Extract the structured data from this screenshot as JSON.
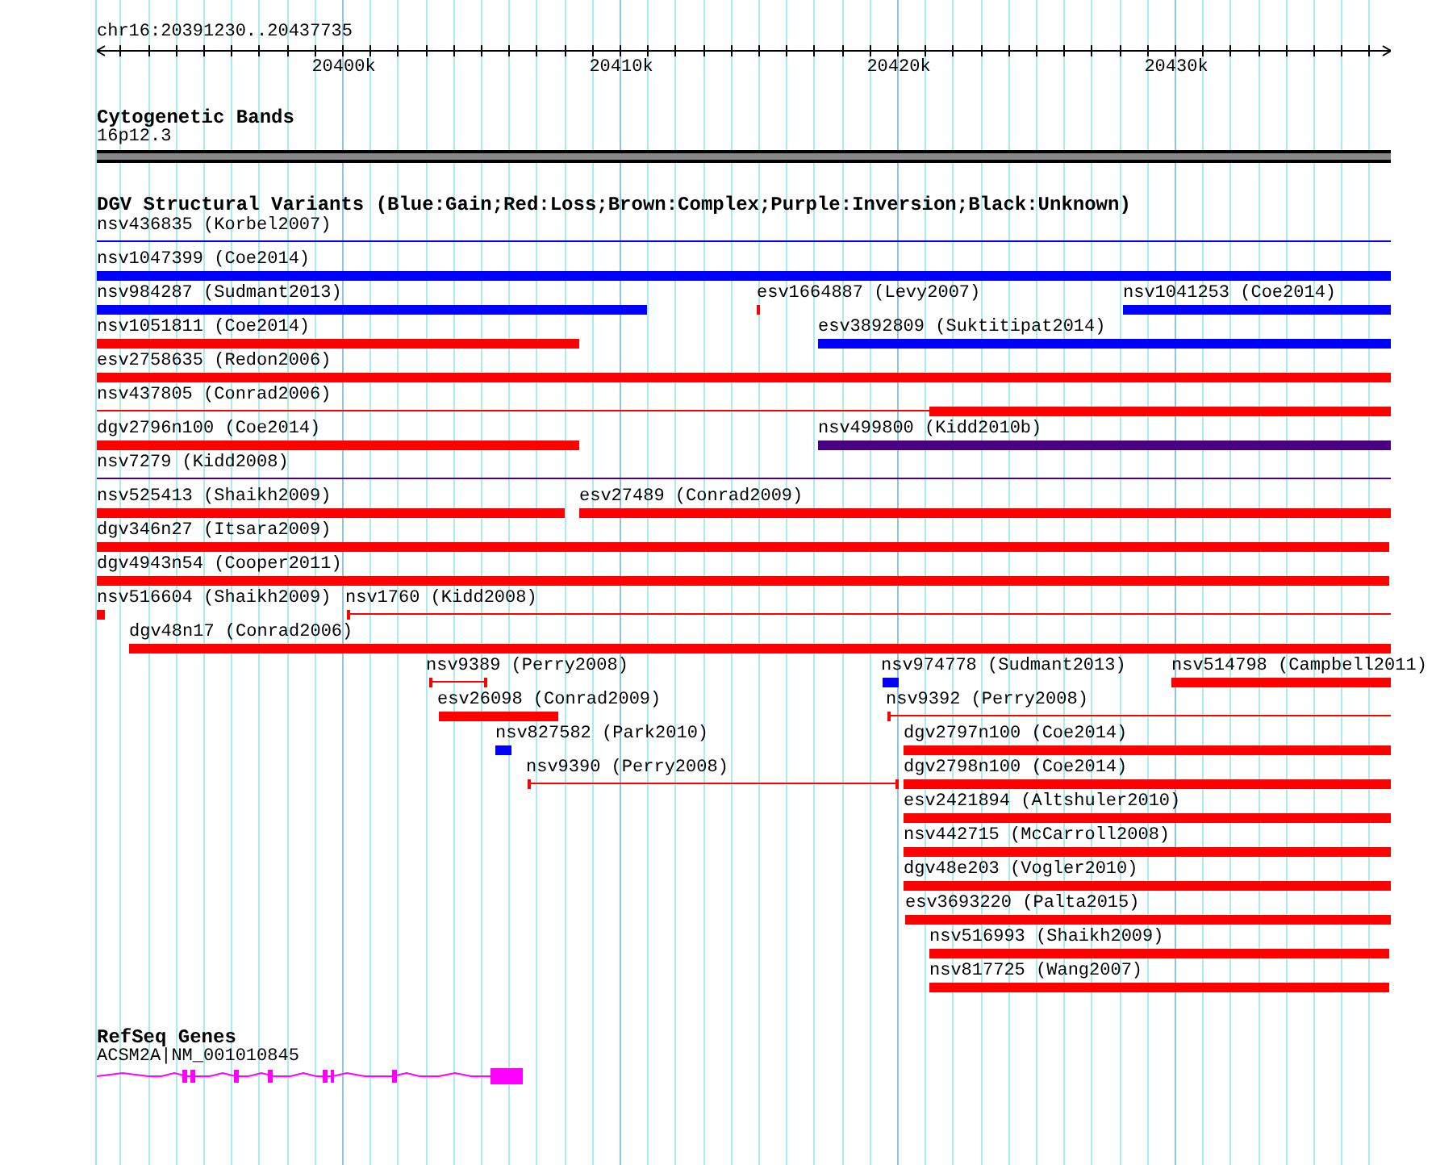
{
  "position": "chr16:20391230..20437735",
  "ruler": {
    "ticks": [
      "20400k",
      "20410k",
      "20420k",
      "20430k"
    ]
  },
  "cytogenetic_bands": {
    "title": "Cytogenetic Bands",
    "band": "16p12.3"
  },
  "dgv": {
    "title": "DGV Structural Variants (Blue:Gain;Red:Loss;Brown:Complex;Purple:Inversion;Black:Unknown)",
    "rows": [
      [
        {
          "label": "nsv436835 (Korbel2007)",
          "color": "#0000ff",
          "kind": "line"
        }
      ],
      [
        {
          "label": "nsv1047399 (Coe2014)",
          "color": "#0000ff",
          "kind": "bar"
        }
      ],
      [
        {
          "label": "nsv984287 (Sudmant2013)",
          "color": "#0000ff",
          "kind": "bar"
        },
        {
          "label": "esv1664887 (Levy2007)",
          "color": "#ff0000",
          "kind": "bar"
        },
        {
          "label": "nsv1041253 (Coe2014)",
          "color": "#0000ff",
          "kind": "bar"
        }
      ],
      [
        {
          "label": "nsv1051811 (Coe2014)",
          "color": "#ff0000",
          "kind": "bar"
        },
        {
          "label": "esv3892809 (Suktitipat2014)",
          "color": "#0000ff",
          "kind": "bar"
        }
      ],
      [
        {
          "label": "esv2758635 (Redon2006)",
          "color": "#ff0000",
          "kind": "bar"
        }
      ],
      [
        {
          "label": "nsv437805 (Conrad2006)",
          "color": "#ff0000",
          "kind": "line_then_bar"
        }
      ],
      [
        {
          "label": "dgv2796n100 (Coe2014)",
          "color": "#ff0000",
          "kind": "bar"
        },
        {
          "label": "nsv499800 (Kidd2010b)",
          "color": "#4b0082",
          "kind": "bar"
        }
      ],
      [
        {
          "label": "nsv7279 (Kidd2008)",
          "color": "#4b0082",
          "kind": "line"
        }
      ],
      [
        {
          "label": "nsv525413 (Shaikh2009)",
          "color": "#ff0000",
          "kind": "bar"
        },
        {
          "label": "esv27489 (Conrad2009)",
          "color": "#ff0000",
          "kind": "bar"
        }
      ],
      [
        {
          "label": "dgv346n27 (Itsara2009)",
          "color": "#ff0000",
          "kind": "bar"
        }
      ],
      [
        {
          "label": "dgv4943n54 (Cooper2011)",
          "color": "#ff0000",
          "kind": "bar"
        }
      ],
      [
        {
          "label": "nsv516604 (Shaikh2009)",
          "color": "#ff0000",
          "kind": "bar"
        },
        {
          "label": "nsv1760 (Kidd2008)",
          "color": "#ff0000",
          "kind": "line_start_tick"
        }
      ],
      [
        {
          "label": "dgv48n17 (Conrad2006)",
          "color": "#ff0000",
          "kind": "bar"
        }
      ],
      [
        {
          "label": "nsv9389 (Perry2008)",
          "color": "#ff0000",
          "kind": "bracket"
        },
        {
          "label": "nsv974778 (Sudmant2013)",
          "color": "#0000ff",
          "kind": "bar"
        },
        {
          "label": "nsv514798 (Campbell2011)",
          "color": "#ff0000",
          "kind": "bar"
        }
      ],
      [
        {
          "label": "esv26098 (Conrad2009)",
          "color": "#ff0000",
          "kind": "bar"
        },
        {
          "label": "nsv9392 (Perry2008)",
          "color": "#ff0000",
          "kind": "line_start_tick"
        }
      ],
      [
        {
          "label": "nsv827582 (Park2010)",
          "color": "#0000ff",
          "kind": "bar"
        },
        {
          "label": "dgv2797n100 (Coe2014)",
          "color": "#ff0000",
          "kind": "bar"
        }
      ],
      [
        {
          "label": "nsv9390 (Perry2008)",
          "color": "#ff0000",
          "kind": "bracket"
        },
        {
          "label": "dgv2798n100 (Coe2014)",
          "color": "#ff0000",
          "kind": "bar"
        }
      ],
      [
        {
          "label": "esv2421894 (Altshuler2010)",
          "color": "#ff0000",
          "kind": "bar"
        }
      ],
      [
        {
          "label": "nsv442715 (McCarroll2008)",
          "color": "#ff0000",
          "kind": "bar"
        }
      ],
      [
        {
          "label": "dgv48e203 (Vogler2010)",
          "color": "#ff0000",
          "kind": "bar"
        }
      ],
      [
        {
          "label": "esv3693220 (Palta2015)",
          "color": "#ff0000",
          "kind": "bar"
        }
      ],
      [
        {
          "label": "nsv516993 (Shaikh2009)",
          "color": "#ff0000",
          "kind": "bar"
        }
      ],
      [
        {
          "label": "nsv817725 (Wang2007)",
          "color": "#ff0000",
          "kind": "bar"
        }
      ]
    ]
  },
  "refseq_genes": {
    "title": "RefSeq Genes",
    "gene": "ACSM2A|NM_001010845"
  }
}
